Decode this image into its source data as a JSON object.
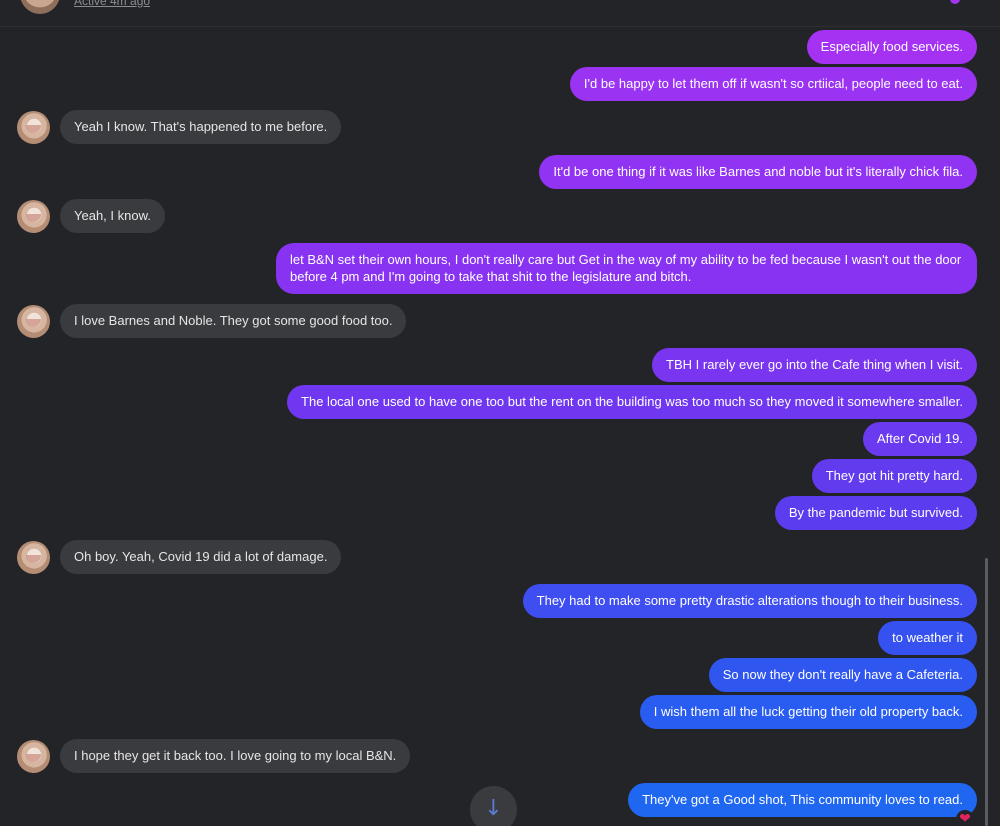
{
  "header": {
    "status_text": "Active 4m ago"
  },
  "messages": [
    {
      "id": "m1",
      "side": "out",
      "text": "Especially food services.",
      "color": "#a532f2"
    },
    {
      "id": "m2",
      "side": "out",
      "text": "I'd be happy to let them off if wasn't so crtiical, people need to eat.",
      "color": "#9b33f2"
    },
    {
      "id": "m3",
      "side": "in",
      "text": "Yeah I know. That's happened to me before."
    },
    {
      "id": "m4",
      "side": "out",
      "text": "It'd be one thing if it was like Barnes and noble but it's literally chick fila.",
      "color": "#9133f2"
    },
    {
      "id": "m5",
      "side": "in",
      "text": "Yeah, I know."
    },
    {
      "id": "m6",
      "side": "out",
      "text": "let B&N set their own hours, I don't really care but  Get in the way of my ability to be fed because I wasn't out the door before 4 pm and I'm going to take that shit to the legislature and bitch.",
      "color": "#8833f2"
    },
    {
      "id": "m7",
      "side": "in",
      "text": "I love Barnes and Noble. They got some good food too."
    },
    {
      "id": "m8",
      "side": "out",
      "text": "TBH I rarely ever go into the Cafe thing when I visit.",
      "color": "#7a35f1"
    },
    {
      "id": "m9",
      "side": "out",
      "text": "The local one used to have one too but the rent on the building was too much so they moved it somewhere smaller.",
      "color": "#6f37f0"
    },
    {
      "id": "m10",
      "side": "out",
      "text": "After Covid 19.",
      "color": "#6a3af0"
    },
    {
      "id": "m11",
      "side": "out",
      "text": "They got hit pretty hard.",
      "color": "#633bef"
    },
    {
      "id": "m12",
      "side": "out",
      "text": "By the pandemic but survived.",
      "color": "#5b3def"
    },
    {
      "id": "m13",
      "side": "in",
      "text": "Oh boy. Yeah, Covid 19 did a lot of damage."
    },
    {
      "id": "m14",
      "side": "out",
      "text": "They had to make some pretty drastic alterations though to their business.",
      "color": "#3e4ef0"
    },
    {
      "id": "m15",
      "side": "out",
      "text": "to weather it",
      "color": "#3552f0"
    },
    {
      "id": "m16",
      "side": "out",
      "text": "So now they don't really have a Cafeteria.",
      "color": "#2f57f0"
    },
    {
      "id": "m17",
      "side": "out",
      "text": "I wish them all the luck getting their old property back.",
      "color": "#295cf0"
    },
    {
      "id": "m18",
      "side": "in",
      "text": "I hope they get it back too. I love going to my local B&N."
    },
    {
      "id": "m19",
      "side": "out",
      "text": "They've got a Good shot, This community loves to read.",
      "color": "#1f66f0"
    }
  ],
  "scroll_down_icon": "arrow-down-icon",
  "reaction_icon": "heart-icon",
  "reaction_glyph": "❤"
}
